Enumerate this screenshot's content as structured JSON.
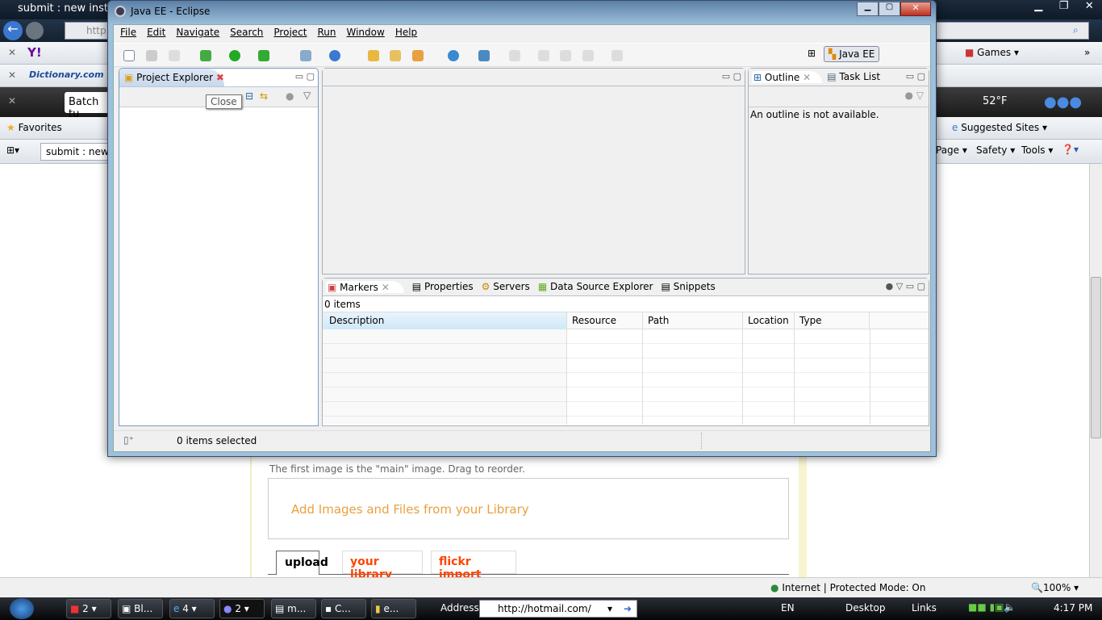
{
  "browser": {
    "title": "submit : new instruct",
    "address": "http:",
    "toolbar_yahoo": "Y!",
    "toolbar_dictionary": "Dictionary.com",
    "msn_search": "Batch tu",
    "weather": "52°F",
    "favorites": "Favorites",
    "tab": "submit : new",
    "games": "Games",
    "suggested_sites": "Suggested Sites",
    "cmd": [
      "Page",
      "Safety",
      "Tools"
    ],
    "status_zone": "Internet | Protected Mode: On",
    "zoom": "100%"
  },
  "webpage": {
    "hint": "The first image is the \"main\" image. Drag to reorder.",
    "library_link": "Add Images and Files from your Library",
    "tabs": [
      "upload",
      "your library",
      "flickr import"
    ],
    "accent": "#e8a040",
    "tab_color": "#ff4400"
  },
  "eclipse": {
    "title": "Java EE - Eclipse",
    "menu": [
      "File",
      "Edit",
      "Navigate",
      "Search",
      "Project",
      "Run",
      "Window",
      "Help"
    ],
    "perspective": "Java EE",
    "project_explorer": "Project Explorer",
    "tooltip": "Close",
    "outline_tab": "Outline",
    "tasklist_tab": "Task List",
    "outline_msg": "An outline is not available.",
    "bottom_tabs": [
      "Markers",
      "Properties",
      "Servers",
      "Data Source Explorer",
      "Snippets"
    ],
    "markers_count": "0 items",
    "columns": [
      "Description",
      "Resource",
      "Path",
      "Location",
      "Type"
    ],
    "status": "0 items selected"
  },
  "taskbar": {
    "buttons": [
      "2",
      "Bl...",
      "4",
      "2",
      "m...",
      "C...",
      "e..."
    ],
    "address_label": "Address",
    "address": "http://hotmail.com/",
    "lang": "EN",
    "desktop": "Desktop",
    "links": "Links",
    "clock": "4:17 PM"
  }
}
